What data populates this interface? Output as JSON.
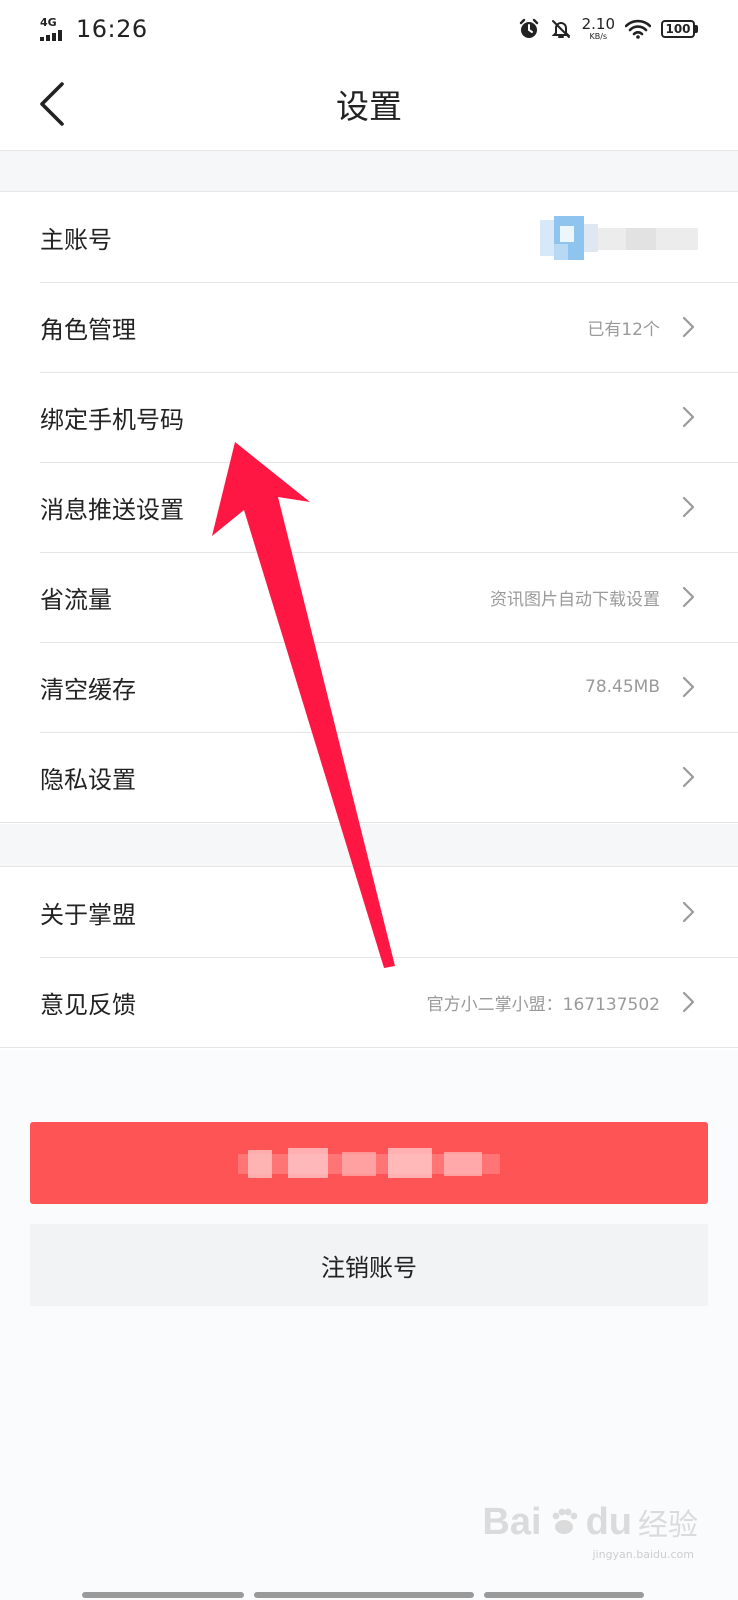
{
  "status_bar": {
    "network": "4G",
    "time": "16:26",
    "speed_value": "2.10",
    "speed_unit": "KB/s",
    "battery": "100"
  },
  "nav": {
    "title": "设置"
  },
  "group1": [
    {
      "label": "主账号",
      "value": ""
    },
    {
      "label": "角色管理",
      "value": "已有12个"
    },
    {
      "label": "绑定手机号码",
      "value": ""
    },
    {
      "label": "消息推送设置",
      "value": ""
    },
    {
      "label": "省流量",
      "value": "资讯图片自动下载设置"
    },
    {
      "label": "清空缓存",
      "value": "78.45MB"
    },
    {
      "label": "隐私设置",
      "value": ""
    }
  ],
  "group2": [
    {
      "label": "关于掌盟",
      "value": ""
    },
    {
      "label": "意见反馈",
      "value": "官方小二掌小盟：167137502"
    }
  ],
  "buttons": {
    "cancel_account": "注销账号"
  },
  "watermark": {
    "brand": "Bai",
    "brand_suffix": "du",
    "brand_cn": "经验",
    "url": "jingyan.baidu.com"
  },
  "colors": {
    "primary_red": "#ff5455",
    "arrow_red": "#ff1744",
    "separator": "#e6e6e6",
    "secondary_text": "#9a9a9a"
  },
  "icons": {
    "back": "chevron-left-icon",
    "row_arrow": "chevron-right-icon",
    "alarm": "alarm-icon",
    "mute": "bell-off-icon",
    "wifi": "wifi-icon",
    "battery": "battery-icon",
    "signal": "signal-icon"
  }
}
